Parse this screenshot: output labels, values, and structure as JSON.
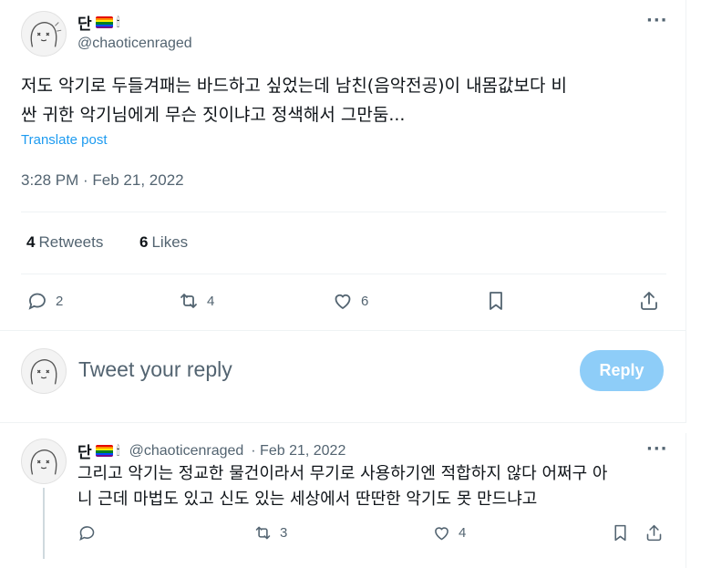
{
  "main_tweet": {
    "display_name": "단",
    "handle": "@chaoticenraged",
    "text_line1": "저도 악기로 두들겨패는 바드하고 싶었는데 남친(음악전공)이 내몸값보다 비",
    "text_line2": "싼 귀한 악기님에게 무슨 짓이냐고 정색해서 그만둠...",
    "translate_label": "Translate post",
    "timestamp": "3:28 PM · Feb 21, 2022",
    "retweets_count": "4",
    "retweets_label": "Retweets",
    "likes_count": "6",
    "likes_label": "Likes",
    "actions": {
      "reply": "2",
      "retweet": "4",
      "like": "6"
    }
  },
  "composer": {
    "placeholder": "Tweet your reply",
    "button_label": "Reply"
  },
  "reply_tweet": {
    "display_name": "단",
    "handle": "@chaoticenraged",
    "date": "· Feb 21, 2022",
    "text_line1": "그리고 악기는 정교한 물건이라서 무기로 사용하기엔 적합하지 않다 어쩌구 아",
    "text_line2": "니 근데 마법도 있고 신도 있는 세상에서 딴딴한 악기도 못 만드냐고",
    "actions": {
      "reply": "",
      "retweet": "3",
      "like": "4"
    }
  },
  "icons": {
    "more": "more-dots-icon",
    "reply": "reply-icon",
    "retweet": "retweet-icon",
    "like": "heart-icon",
    "bookmark": "bookmark-icon",
    "share": "share-icon",
    "flag": "rainbow-flag-icon",
    "candle": "candle-icon"
  },
  "colors": {
    "accent": "#1d9bf0",
    "reply_button": "#8ecdf8",
    "muted": "#536471"
  }
}
